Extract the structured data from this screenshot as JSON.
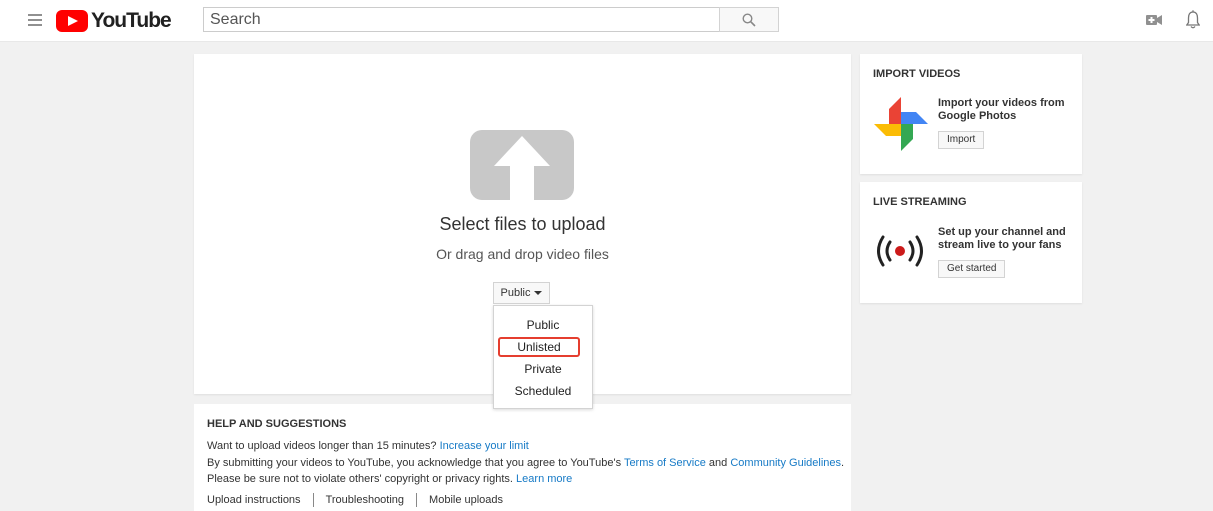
{
  "header": {
    "logo_text": "YouTube",
    "search_placeholder": "Search"
  },
  "upload": {
    "title": "Select files to upload",
    "subtitle": "Or drag and drop video files",
    "privacy_selected": "Public",
    "privacy_options": [
      "Public",
      "Unlisted",
      "Private",
      "Scheduled"
    ],
    "highlighted_option": "Unlisted"
  },
  "help": {
    "title": "HELP AND SUGGESTIONS",
    "line1_text": "Want to upload videos longer than 15 minutes?",
    "line1_link": "Increase your limit",
    "line2_text": "By submitting your videos to YouTube, you acknowledge that you agree to YouTube's",
    "line2_link1": "Terms of Service",
    "line2_and": "and",
    "line2_link2": "Community Guidelines",
    "line2_end": ".",
    "line3_text": "Please be sure not to violate others' copyright or privacy rights.",
    "line3_link": "Learn more",
    "links": [
      "Upload instructions",
      "Troubleshooting",
      "Mobile uploads"
    ]
  },
  "import_videos": {
    "title": "IMPORT VIDEOS",
    "text": "Import your videos from Google Photos",
    "button": "Import"
  },
  "live_streaming": {
    "title": "LIVE STREAMING",
    "text": "Set up your channel and stream live to your fans",
    "button": "Get started"
  },
  "icons": {
    "menu": "hamburger-menu-icon",
    "search": "search-icon",
    "create": "video-camera-icon",
    "notifications": "bell-icon",
    "upload": "upload-arrow-icon",
    "photos": "google-photos-pinwheel-icon",
    "live": "live-broadcast-icon"
  },
  "colors": {
    "brand_red": "#ff0000",
    "link_blue": "#167ac6",
    "highlight_red": "#e53e2f",
    "live_dot": "#cc1a1a"
  }
}
